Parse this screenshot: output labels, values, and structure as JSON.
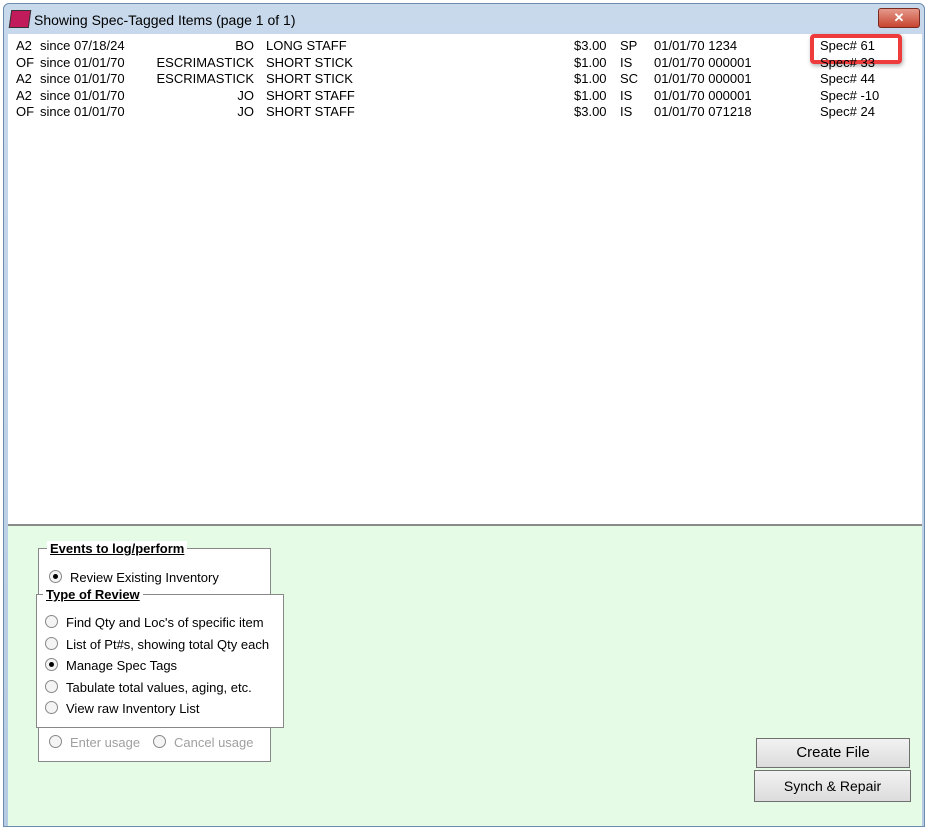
{
  "window": {
    "title": "Showing Spec-Tagged Items (page 1 of 1)",
    "close_label": "✕"
  },
  "rows": [
    {
      "loc": "A2",
      "since": "since 07/18/24",
      "code": "BO",
      "desc": "LONG STAFF",
      "price": "$3.00",
      "type": "SP",
      "date": "01/01/70 1234",
      "spec": "Spec# 61"
    },
    {
      "loc": "OF",
      "since": "since 01/01/70",
      "code": "ESCRIMASTICK",
      "desc": "SHORT STICK",
      "price": "$1.00",
      "type": "IS",
      "date": "01/01/70 000001",
      "spec": "Spec# 33"
    },
    {
      "loc": "A2",
      "since": "since 01/01/70",
      "code": "ESCRIMASTICK",
      "desc": "SHORT STICK",
      "price": "$1.00",
      "type": "SC",
      "date": "01/01/70 000001",
      "spec": "Spec# 44"
    },
    {
      "loc": "A2",
      "since": "since 01/01/70",
      "code": "JO",
      "desc": "SHORT STAFF",
      "price": "$1.00",
      "type": "IS",
      "date": "01/01/70 000001",
      "spec": "Spec# -10"
    },
    {
      "loc": "OF",
      "since": "since 01/01/70",
      "code": "JO",
      "desc": "SHORT STAFF",
      "price": "$3.00",
      "type": "IS",
      "date": "01/01/70 071218",
      "spec": "Spec# 24"
    }
  ],
  "events": {
    "label": "Events to log/perform",
    "review": "Review Existing Inventory",
    "enter": "Enter usage",
    "cancel": "Cancel usage"
  },
  "review": {
    "label": "Type of Review",
    "options": [
      "Find Qty and Loc's of specific item",
      "List of Pt#s, showing total Qty each",
      "Manage Spec Tags",
      "Tabulate total values, aging, etc.",
      "View raw Inventory List"
    ],
    "selected": 2
  },
  "buttons": {
    "create": "Create File",
    "synch": "Synch & Repair"
  },
  "colors": {
    "highlight": "#ee3b3b",
    "panel": "#e6fbe6"
  }
}
